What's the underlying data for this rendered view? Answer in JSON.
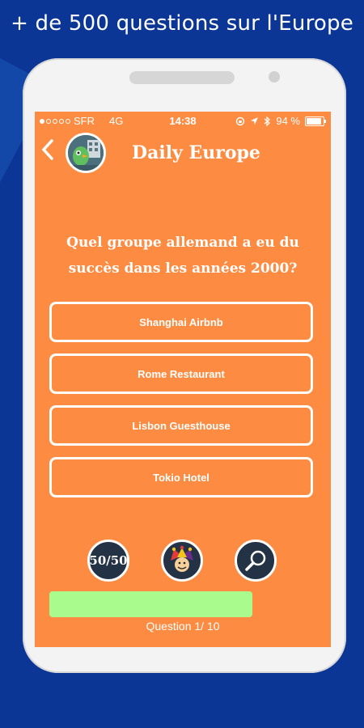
{
  "promo": {
    "text": "+ de 500 questions sur l'Europe"
  },
  "status_bar": {
    "carrier": "SFR",
    "network": "4G",
    "time": "14:38",
    "battery": "94 %"
  },
  "header": {
    "title": "Daily Europe",
    "back_icon": "chevron-left-icon",
    "avatar_icon": "bird-avatar-icon"
  },
  "question": {
    "line1": "Quel groupe allemand a eu du",
    "line2": "succès dans les années 2000?"
  },
  "answers": [
    {
      "label": "Shanghai Airbnb"
    },
    {
      "label": "Rome Restaurant"
    },
    {
      "label": "Lisbon Guesthouse"
    },
    {
      "label": "Tokio Hotel"
    }
  ],
  "jokers": {
    "fifty": "50/50",
    "jester_icon": "jester-icon",
    "search_icon": "magnifier-icon"
  },
  "progress": {
    "fraction": 0.1,
    "label": "Question 1/ 10"
  },
  "colors": {
    "screen": "#fd8c42",
    "background": "#0b3696",
    "progress": "#a9fb8d",
    "joker": "#243246"
  }
}
